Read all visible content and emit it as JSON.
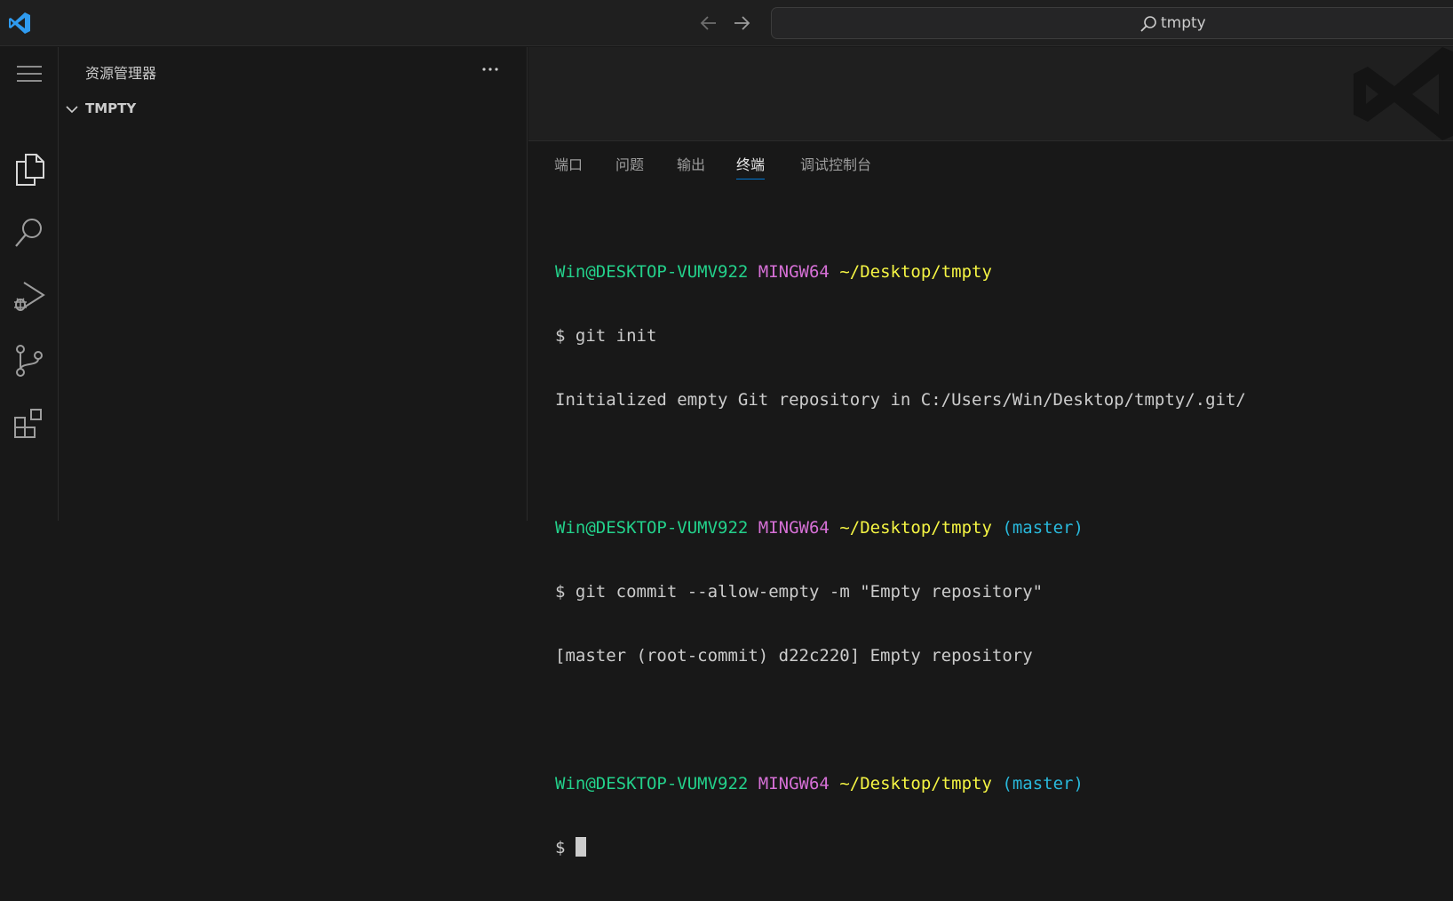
{
  "titlebar": {
    "logo_icon": "vscode-logo-icon",
    "search_text": "tmpty",
    "accent": "#0078d4"
  },
  "activitybar": {
    "items": [
      {
        "name": "menu",
        "icon": "hamburger-menu-icon"
      },
      {
        "name": "explorer",
        "icon": "files-icon"
      },
      {
        "name": "search",
        "icon": "search-icon"
      },
      {
        "name": "run-debug",
        "icon": "run-debug-icon"
      },
      {
        "name": "source-control",
        "icon": "source-control-icon"
      },
      {
        "name": "extensions",
        "icon": "extensions-icon"
      }
    ]
  },
  "sidebar": {
    "title": "资源管理器",
    "folder": "TMPTY"
  },
  "panel": {
    "tabs": [
      {
        "label": "端口",
        "active": false
      },
      {
        "label": "问题",
        "active": false
      },
      {
        "label": "输出",
        "active": false
      },
      {
        "label": "终端",
        "active": true
      },
      {
        "label": "调试控制台",
        "active": false
      }
    ]
  },
  "terminal": {
    "user_host": "Win@DESKTOP-VUMV922",
    "env": "MINGW64",
    "path": "~/Desktop/tmpty",
    "branch": "(master)",
    "prompt": "$",
    "cmd1": "git init",
    "out1": "Initialized empty Git repository in C:/Users/Win/Desktop/tmpty/.git/",
    "cmd2": "git commit --allow-empty -m \"Empty repository\"",
    "out2": "[master (root-commit) d22c220] Empty repository",
    "colors": {
      "user": "#23d18b",
      "env": "#d670d6",
      "path": "#f5f543",
      "branch": "#29b8db"
    }
  }
}
